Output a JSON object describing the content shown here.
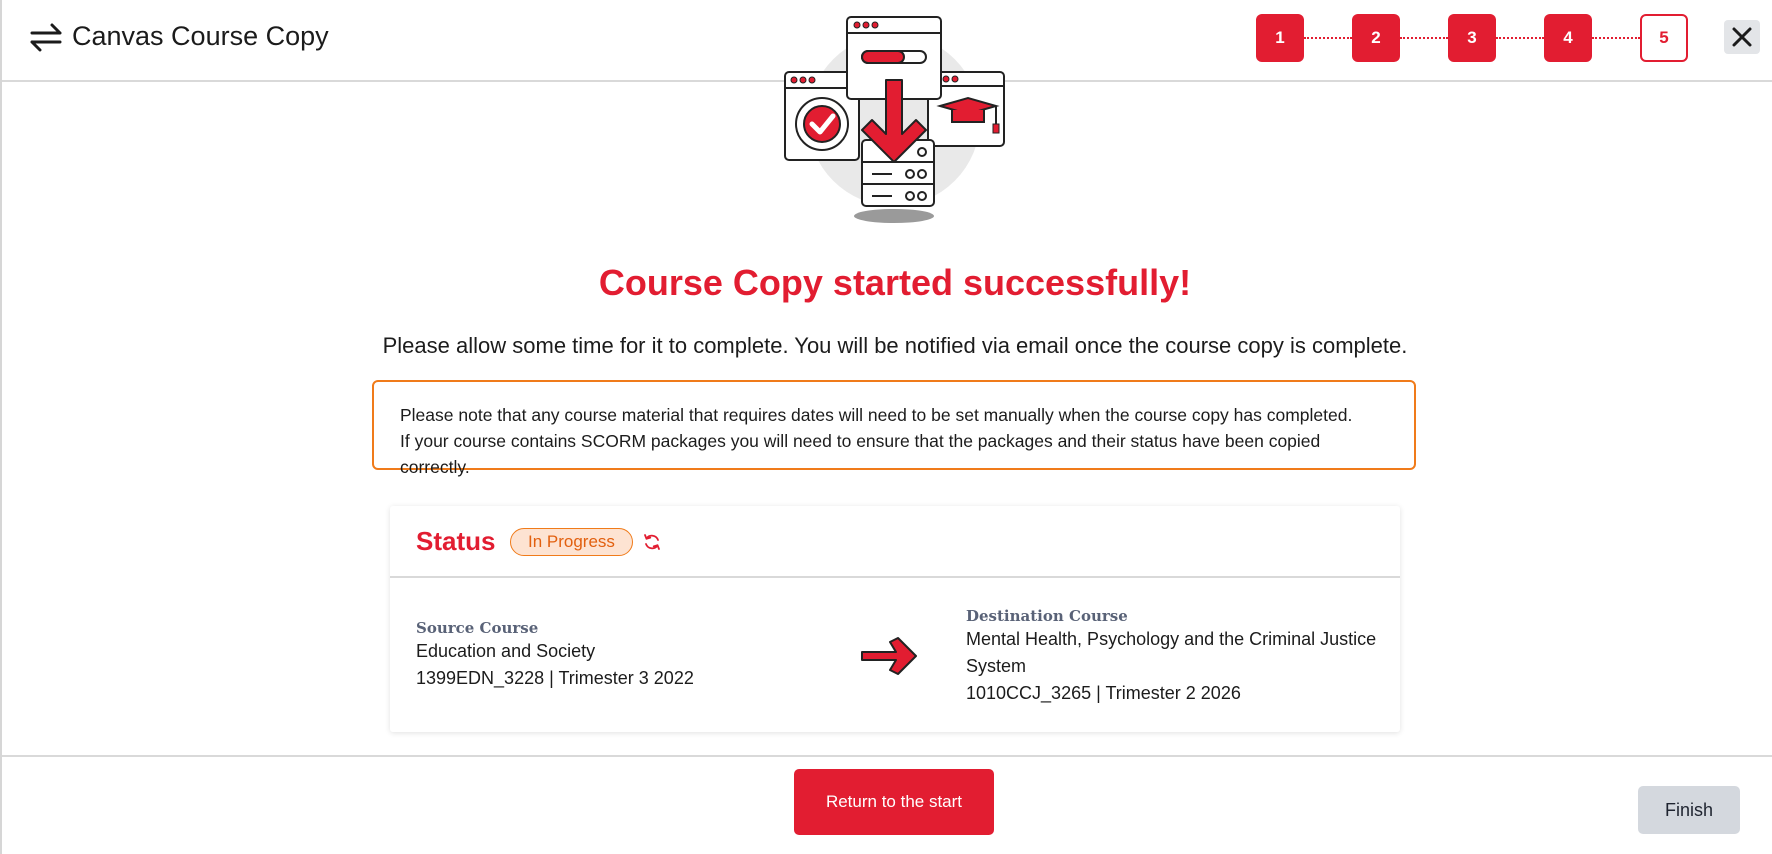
{
  "header": {
    "app_icon": "swap-arrows-icon",
    "title": "Canvas Course Copy",
    "close_icon": "close-icon"
  },
  "stepper": {
    "steps": [
      "1",
      "2",
      "3",
      "4",
      "5"
    ],
    "current_step": "5"
  },
  "illustration": {
    "icon": "course-copy-download-illustration"
  },
  "main": {
    "headline": "Course Copy started successfully!",
    "subline": "Please allow some time for it to complete. You will be notified via email once the course copy is complete.",
    "notice_line1": "Please note that any course material that requires dates will need to be set manually when the course copy has completed.",
    "notice_line2": "If your course contains SCORM packages you will need to ensure that the packages and their status have been copied correctly."
  },
  "status": {
    "title": "Status",
    "badge": "In Progress",
    "refresh_icon": "refresh-icon",
    "source": {
      "label": "Source Course",
      "name": "Education and Society",
      "detail": "1399EDN_3228 | Trimester 3 2022"
    },
    "destination": {
      "label": "Destination Course",
      "name": "Mental Health, Psychology and the Criminal Justice System",
      "detail": "1010CCJ_3265 | Trimester 2 2026"
    },
    "arrow_icon": "arrow-right-icon"
  },
  "footer": {
    "return_label": "Return to the start",
    "finish_label": "Finish"
  },
  "colors": {
    "brand_red": "#e21d31",
    "notice_orange": "#f07b1a",
    "badge_bg": "#fde3d2",
    "finish_bg": "#d4d8de"
  }
}
